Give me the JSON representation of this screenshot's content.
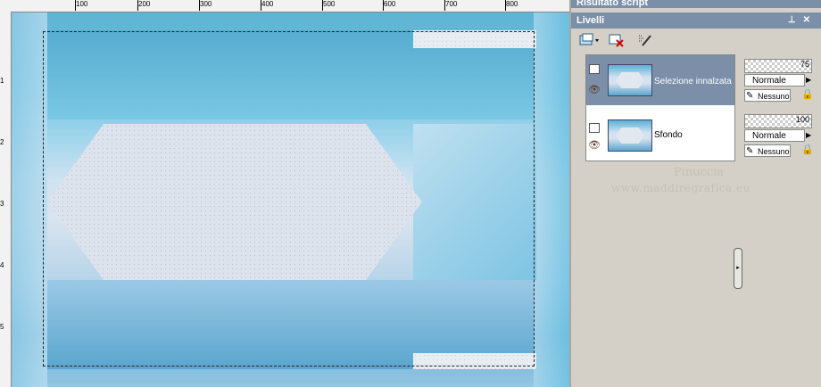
{
  "ruler": {
    "top_ticks": [
      "100",
      "200",
      "300",
      "400",
      "500",
      "600",
      "700",
      "800"
    ],
    "left_ticks": [
      "1",
      "2",
      "3",
      "4",
      "5"
    ]
  },
  "panels": {
    "script_title": "Risultato script",
    "layers_title": "Livelli"
  },
  "layers": [
    {
      "name": "Selezione innalzata",
      "opacity": "75",
      "blend": "Normale",
      "mask": "Nessuno",
      "selected": true
    },
    {
      "name": "Sfondo",
      "opacity": "100",
      "blend": "Normale",
      "mask": "Nessuno",
      "selected": false
    }
  ],
  "watermark": {
    "line1": "Pinuccia",
    "line2": "www.maddiregrafica.eu"
  },
  "colors": {
    "title_bar": "#7b8fa9",
    "selected_row": "#7b8fa9",
    "panel_bg": "#d4d0c8"
  },
  "icons": {
    "new_layer": "new-layer-icon",
    "delete_layer": "delete-layer-icon",
    "edit_layer": "edit-layer-icon",
    "visibility": "eye-icon",
    "lock": "lock-icon"
  }
}
